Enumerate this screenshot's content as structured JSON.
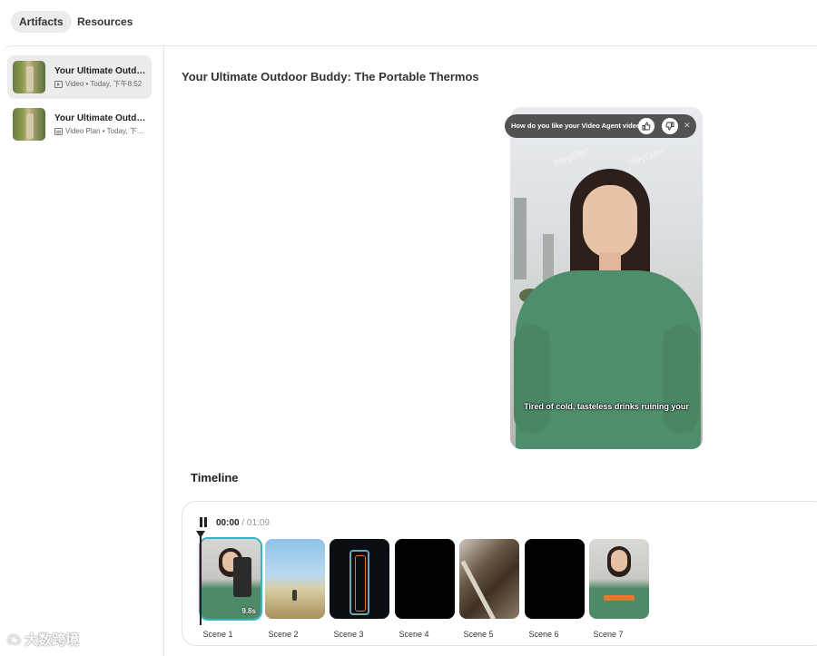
{
  "tabs": {
    "artifacts": "Artifacts",
    "resources": "Resources"
  },
  "sidebar": {
    "items": [
      {
        "title": "Your Ultimate Outdo...",
        "icon": "video-icon",
        "meta": "Video • Today, 下午8:52",
        "selected": true
      },
      {
        "title": "Your Ultimate Outdo...",
        "icon": "video-plan-icon",
        "meta": "Video Plan • Today, 下...",
        "selected": false
      }
    ]
  },
  "main": {
    "title": "Your Ultimate Outdoor Buddy: The Portable Thermos"
  },
  "video": {
    "feedback_prompt": "How do you like your Video Agent video?",
    "caption": "Tired of cold, tasteless drinks ruining your",
    "watermark_1": "HeyGen",
    "watermark_2": "HeyGen"
  },
  "timeline": {
    "heading": "Timeline",
    "current_time": "00:00",
    "separator": "/",
    "duration": "01:09",
    "playing": true,
    "scenes": [
      {
        "label": "Scene 1",
        "duration": "9.8s",
        "active": true
      },
      {
        "label": "Scene 2"
      },
      {
        "label": "Scene 3"
      },
      {
        "label": "Scene 4"
      },
      {
        "label": "Scene 5"
      },
      {
        "label": "Scene 6"
      },
      {
        "label": "Scene 7"
      }
    ]
  },
  "watermark": "大数跨境",
  "colors": {
    "accent": "#37b4c8",
    "shirt": "#4f8e6c"
  }
}
